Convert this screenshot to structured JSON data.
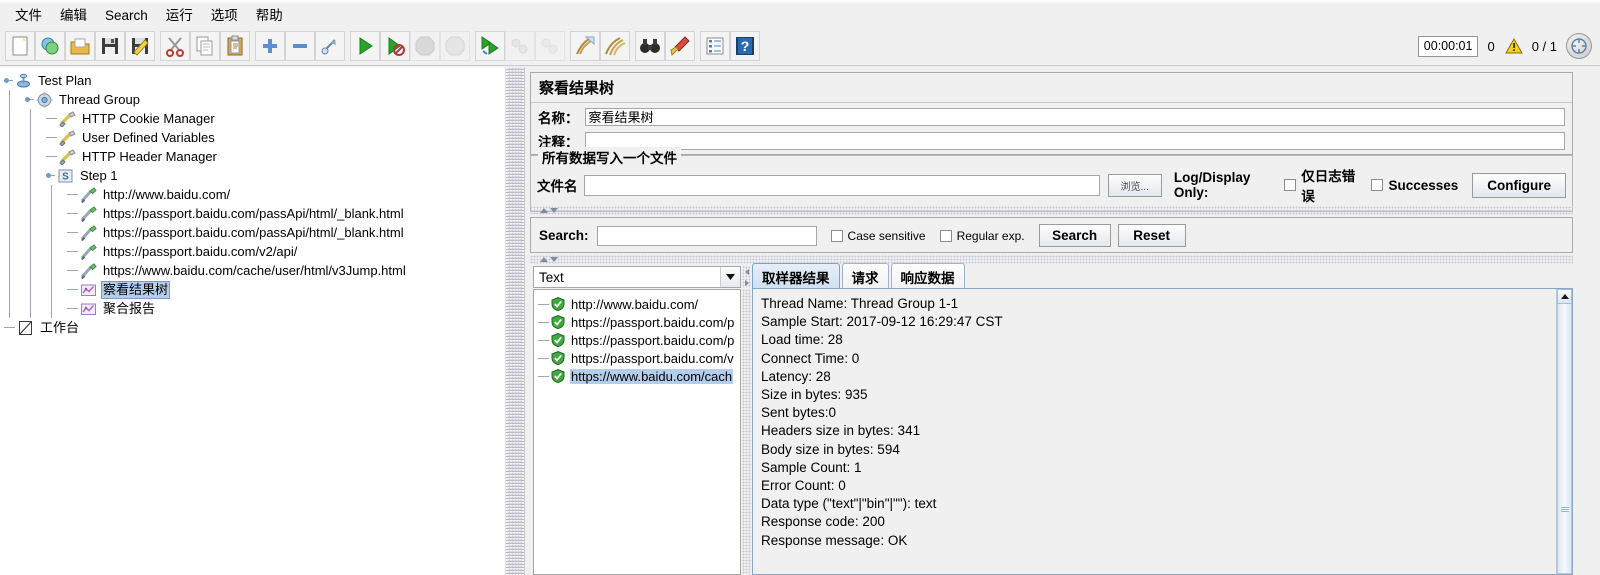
{
  "menu": {
    "items": [
      {
        "label": "文件",
        "name": "menu-file"
      },
      {
        "label": "编辑",
        "name": "menu-edit"
      },
      {
        "label": "Search",
        "name": "menu-search"
      },
      {
        "label": "运行",
        "name": "menu-run"
      },
      {
        "label": "选项",
        "name": "menu-options"
      },
      {
        "label": "帮助",
        "name": "menu-help"
      }
    ]
  },
  "toolbar": {
    "groups": [
      {
        "buttons": [
          {
            "icon": "new-document-icon",
            "disabled": false
          },
          {
            "icon": "templates-icon",
            "disabled": false
          },
          {
            "icon": "open-folder-icon",
            "disabled": false
          },
          {
            "icon": "save-icon",
            "disabled": false
          },
          {
            "icon": "save-as-icon",
            "disabled": false
          }
        ]
      },
      {
        "buttons": [
          {
            "icon": "cut-scissors-icon",
            "disabled": false
          },
          {
            "icon": "copy-icon",
            "disabled": false
          },
          {
            "icon": "paste-clipboard-icon",
            "disabled": false
          }
        ]
      },
      {
        "buttons": [
          {
            "icon": "expand-plus-icon",
            "disabled": false
          },
          {
            "icon": "collapse-minus-icon",
            "disabled": false
          },
          {
            "icon": "toggle-icon",
            "disabled": false
          }
        ]
      },
      {
        "buttons": [
          {
            "icon": "start-play-icon",
            "disabled": false
          },
          {
            "icon": "start-no-pauses-icon",
            "disabled": false
          },
          {
            "icon": "stop-icon",
            "disabled": true
          },
          {
            "icon": "shutdown-icon",
            "disabled": true
          }
        ]
      },
      {
        "buttons": [
          {
            "icon": "remote-start-icon",
            "disabled": false
          },
          {
            "icon": "remote-stop-icon",
            "disabled": true
          },
          {
            "icon": "remote-shutdown-icon",
            "disabled": true
          }
        ]
      },
      {
        "buttons": [
          {
            "icon": "clear-icon",
            "disabled": false
          },
          {
            "icon": "clear-all-icon",
            "disabled": false
          }
        ]
      },
      {
        "buttons": [
          {
            "icon": "search-binoculars-icon",
            "disabled": false
          },
          {
            "icon": "reset-search-broom-icon",
            "disabled": false
          }
        ]
      },
      {
        "buttons": [
          {
            "icon": "function-helper-icon",
            "disabled": false
          },
          {
            "icon": "help-question-icon",
            "disabled": false
          }
        ]
      }
    ],
    "status": {
      "timer": "00:00:01",
      "error_count": "0",
      "warning_icon": "warning-triangle-icon",
      "threads": "0 / 1",
      "stop_icon": "stop-all-threads-icon"
    }
  },
  "tree": {
    "nodes": [
      {
        "label": "Test Plan",
        "depth": 0,
        "icon": "test-plan-icon",
        "handle": true,
        "selected": false
      },
      {
        "label": "Thread Group",
        "depth": 1,
        "icon": "thread-group-icon",
        "handle": true,
        "selected": false
      },
      {
        "label": "HTTP Cookie Manager",
        "depth": 2,
        "icon": "config-element-icon",
        "handle": false,
        "selected": false
      },
      {
        "label": "User Defined Variables",
        "depth": 2,
        "icon": "config-element-icon",
        "handle": false,
        "selected": false
      },
      {
        "label": "HTTP Header Manager",
        "depth": 2,
        "icon": "config-element-icon",
        "handle": false,
        "selected": false
      },
      {
        "label": "Step 1",
        "depth": 2,
        "icon": "transaction-controller-icon",
        "handle": true,
        "selected": false
      },
      {
        "label": "http://www.baidu.com/",
        "depth": 3,
        "icon": "http-sampler-icon",
        "handle": false,
        "selected": false
      },
      {
        "label": "https://passport.baidu.com/passApi/html/_blank.html",
        "depth": 3,
        "icon": "http-sampler-icon",
        "handle": false,
        "selected": false
      },
      {
        "label": "https://passport.baidu.com/passApi/html/_blank.html",
        "depth": 3,
        "icon": "http-sampler-icon",
        "handle": false,
        "selected": false
      },
      {
        "label": "https://passport.baidu.com/v2/api/",
        "depth": 3,
        "icon": "http-sampler-icon",
        "handle": false,
        "selected": false
      },
      {
        "label": "https://www.baidu.com/cache/user/html/v3Jump.html",
        "depth": 3,
        "icon": "http-sampler-icon",
        "handle": false,
        "selected": false
      },
      {
        "label": "察看结果树",
        "depth": 3,
        "icon": "listener-icon",
        "handle": false,
        "selected": true
      },
      {
        "label": "聚合报告",
        "depth": 3,
        "icon": "listener-icon",
        "handle": false,
        "selected": false
      },
      {
        "label": "工作台",
        "depth": 0,
        "icon": "workbench-icon",
        "handle": false,
        "selected": false
      }
    ]
  },
  "panel": {
    "title": "察看结果树",
    "name_label": "名称：",
    "name_value": "察看结果树",
    "comment_label": "注释：",
    "comment_value": "",
    "file_group_title": "所有数据写入一个文件",
    "filename_label": "文件名",
    "filename_value": "",
    "browse_label": "浏览...",
    "log_display_label": "Log/Display Only:",
    "errors_only_label": "仅日志错误",
    "successes_label": "Successes",
    "configure_label": "Configure"
  },
  "search": {
    "label": "Search:",
    "value": "",
    "case_sensitive_label": "Case sensitive",
    "regular_exp_label": "Regular exp.",
    "search_button": "Search",
    "reset_button": "Reset"
  },
  "renderer": {
    "selected": "Text"
  },
  "results": {
    "items": [
      {
        "label": "http://www.baidu.com/",
        "status": "success",
        "selected": false
      },
      {
        "label": "https://passport.baidu.com/p",
        "status": "success",
        "selected": false
      },
      {
        "label": "https://passport.baidu.com/p",
        "status": "success",
        "selected": false
      },
      {
        "label": "https://passport.baidu.com/v",
        "status": "success",
        "selected": false
      },
      {
        "label": "https://www.baidu.com/cach",
        "status": "success",
        "selected": true
      }
    ]
  },
  "tabs": [
    {
      "label": "取样器结果",
      "active": true,
      "name": "tab-sampler-result"
    },
    {
      "label": "请求",
      "active": false,
      "name": "tab-request"
    },
    {
      "label": "响应数据",
      "active": false,
      "name": "tab-response-data"
    }
  ],
  "sampler_result": {
    "lines": [
      "Thread Name: Thread Group 1-1",
      "Sample Start: 2017-09-12 16:29:47 CST",
      "Load time: 28",
      "Connect Time: 0",
      "Latency: 28",
      "Size in bytes: 935",
      "Sent bytes:0",
      "Headers size in bytes: 341",
      "Body size in bytes: 594",
      "Sample Count: 1",
      "Error Count: 0",
      "Data type (\"text\"|\"bin\"|\"\"): text",
      "Response code: 200",
      "Response message: OK"
    ]
  },
  "colors": {
    "accent": "#b4cdeb",
    "success": "#2fa32f",
    "warning": "#f5c518",
    "panel_bg": "#f0f0f0"
  }
}
